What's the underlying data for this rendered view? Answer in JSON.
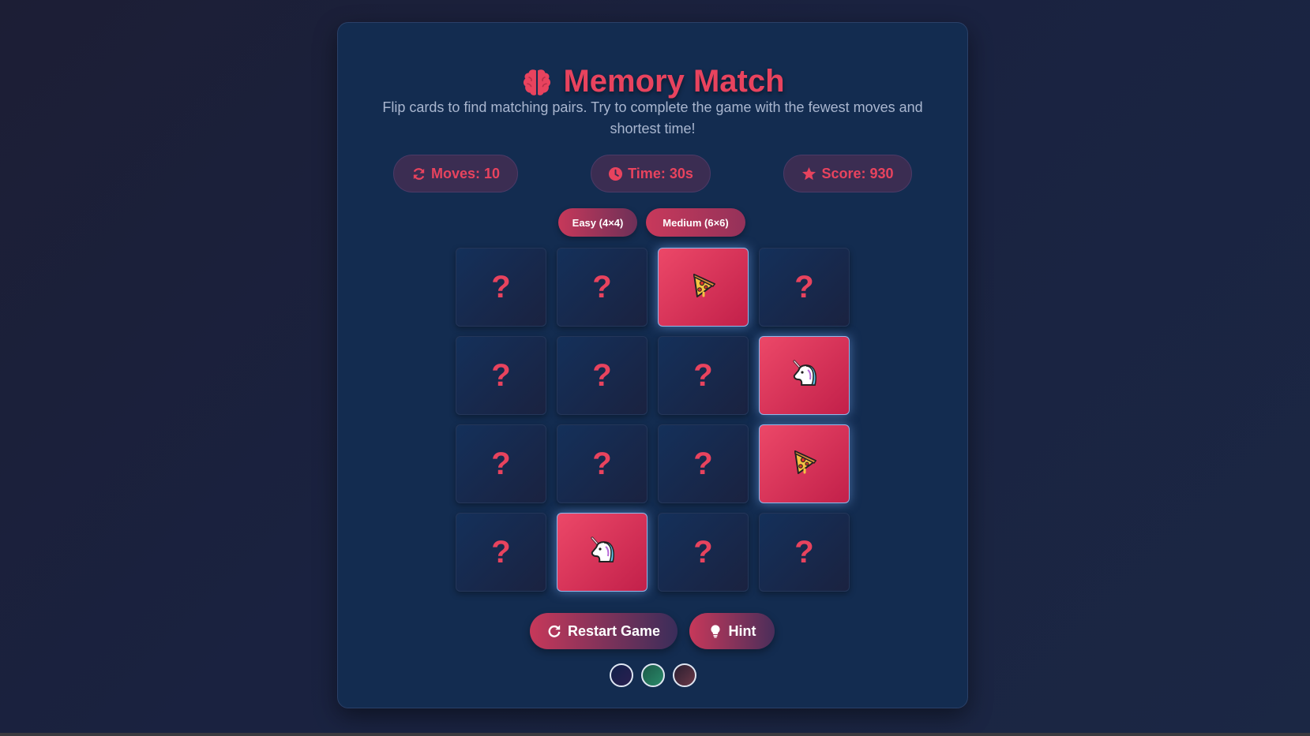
{
  "app": {
    "title": "Memory Match",
    "subtitle": "Flip cards to find matching pairs. Try to complete the game with the fewest moves and shortest time!"
  },
  "stats": {
    "moves_label": "Moves: 10",
    "time_label": "Time: 30s",
    "score_label": "Score: 930"
  },
  "difficulty": {
    "easy_label": "Easy (4×4)",
    "medium_label": "Medium (6×6)"
  },
  "board": {
    "hidden_symbol": "?",
    "cards": [
      {
        "state": "hidden"
      },
      {
        "state": "hidden"
      },
      {
        "state": "flipped",
        "icon": "pizza-icon"
      },
      {
        "state": "hidden"
      },
      {
        "state": "hidden"
      },
      {
        "state": "hidden"
      },
      {
        "state": "hidden"
      },
      {
        "state": "flipped",
        "icon": "unicorn-icon"
      },
      {
        "state": "hidden"
      },
      {
        "state": "hidden"
      },
      {
        "state": "hidden"
      },
      {
        "state": "flipped",
        "icon": "pizza-icon"
      },
      {
        "state": "hidden"
      },
      {
        "state": "flipped",
        "icon": "unicorn-icon"
      },
      {
        "state": "hidden"
      },
      {
        "state": "hidden"
      }
    ]
  },
  "actions": {
    "restart_label": "Restart Game",
    "hint_label": "Hint"
  },
  "themes": [
    "dark-blue",
    "green",
    "maroon"
  ],
  "colors": {
    "accent": "#e8435e",
    "panel": "#132c50",
    "card_back": "#14305a",
    "card_face": "#ec4868"
  },
  "icons": {
    "title": "brain-icon",
    "moves": "refresh-icon",
    "time": "clock-icon",
    "score": "star-icon",
    "restart": "restart-icon",
    "hint": "lightbulb-icon"
  }
}
